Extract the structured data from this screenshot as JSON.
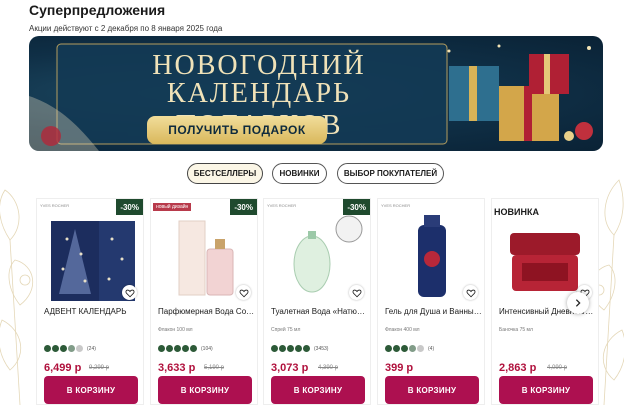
{
  "header": {
    "title": "Суперпредложения",
    "subtitle": "Акции действуют с 2 декабря по 8 января 2025 года"
  },
  "banner": {
    "line1": "НОВОГОДНИЙ",
    "line2": "КАЛЕНДАРЬ ПОДАРКОВ",
    "button_label": "ПОЛУЧИТЬ ПОДАРОК",
    "bg_color": "#0f2f46",
    "accent_color": "#e4c778"
  },
  "tabs": [
    {
      "label": "БЕСТСЕЛЛЕРЫ",
      "active": true
    },
    {
      "label": "НОВИНКИ",
      "active": false
    },
    {
      "label": "ВЫБОР ПОКУПАТЕЛЕЙ",
      "active": false
    }
  ],
  "products": [
    {
      "name": "АДВЕНТ КАЛЕНДАРЬ",
      "volume": "",
      "discount": "-30%",
      "badge": "",
      "rating": 3.5,
      "reviews": "(24)",
      "price": "6,499 р",
      "old_price": "9,299 р",
      "cart_label": "В КОРЗИНУ",
      "brand_tiny": "YVES ROCHER"
    },
    {
      "name": "Парфюмерная Вода Comme Une Evidence",
      "volume": "Флакон 100 мл",
      "discount": "-30%",
      "badge": "новый дизайн",
      "rating": 5,
      "reviews": "(104)",
      "price": "3,633 р",
      "old_price": "5,190 р",
      "cart_label": "В КОРЗИНУ",
      "brand_tiny": ""
    },
    {
      "name": "Туалетная Вода «Натюрэль», 75 мл",
      "volume": "Спрей 75 мл",
      "discount": "-30%",
      "badge": "",
      "rating": 5,
      "reviews": "(3453)",
      "price": "3,073 р",
      "old_price": "4,390 р",
      "cart_label": "В КОРЗИНУ",
      "brand_tiny": "YVES ROCHER"
    },
    {
      "name": "Гель для Душа и Ванны «Гранат и…",
      "volume": "Флакон 400 мл",
      "discount": "",
      "badge": "",
      "rating": 3.5,
      "reviews": "(4)",
      "price": "399 р",
      "old_price": "",
      "cart_label": "В КОРЗИНУ",
      "brand_tiny": "YVES ROCHER"
    },
    {
      "name": "Интенсивный Дневной/Ночной…",
      "volume": "Баночка 75 мл",
      "discount": "",
      "badge": "НОВИНКА",
      "rating": 0,
      "reviews": "",
      "price": "2,863 р",
      "old_price": "4,090 р",
      "cart_label": "В КОРЗИНУ",
      "brand_tiny": ""
    }
  ],
  "icons": {
    "heart": "heart-icon",
    "next": "chevron-right-icon"
  },
  "colors": {
    "cart_button": "#ad1050",
    "price": "#b0103c",
    "discount_badge": "#1f4a2e",
    "star": "#2d5a38"
  }
}
